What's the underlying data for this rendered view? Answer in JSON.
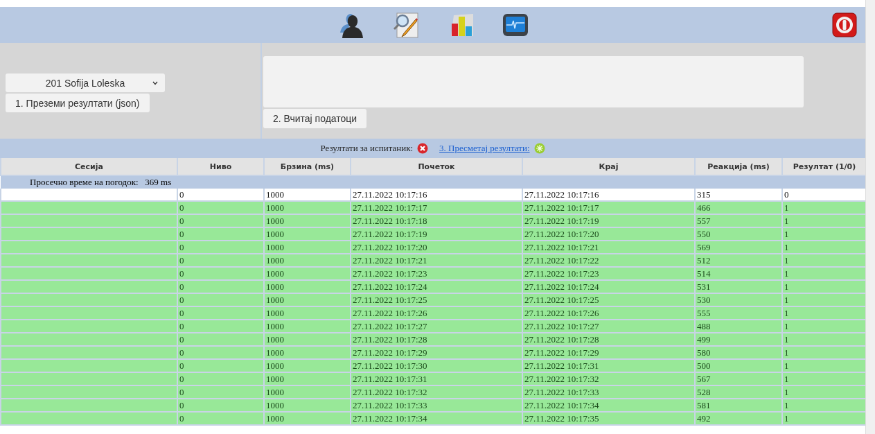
{
  "toolbar": {
    "icons": [
      {
        "kind": "person"
      },
      {
        "kind": "search-edit"
      },
      {
        "kind": "chart"
      },
      {
        "kind": "monitor"
      }
    ]
  },
  "subject_select": {
    "value": "201 Sofija Loleska"
  },
  "download_button": "1. Преземи резултати (json)",
  "load_button": "2. Вчитај податоци",
  "results_title": "Резултати за испитаник:",
  "calculate_link": "3. Пресметај резултати:",
  "table": {
    "columns": [
      "Сесија",
      "Ниво",
      "Брзина (ms)",
      "Почеток",
      "Крај",
      "Реакција (ms)",
      "Резултат (1/0)"
    ],
    "summary": "Просечно време на погодок:   369 ms",
    "rows": [
      {
        "correct": false,
        "cells": [
          "",
          "0",
          "1000",
          "27.11.2022 10:17:16",
          "27.11.2022 10:17:16",
          "315",
          "0"
        ]
      },
      {
        "correct": true,
        "cells": [
          "",
          "0",
          "1000",
          "27.11.2022 10:17:17",
          "27.11.2022 10:17:17",
          "466",
          "1"
        ]
      },
      {
        "correct": true,
        "cells": [
          "",
          "0",
          "1000",
          "27.11.2022 10:17:18",
          "27.11.2022 10:17:19",
          "557",
          "1"
        ]
      },
      {
        "correct": true,
        "cells": [
          "",
          "0",
          "1000",
          "27.11.2022 10:17:19",
          "27.11.2022 10:17:20",
          "550",
          "1"
        ]
      },
      {
        "correct": true,
        "cells": [
          "",
          "0",
          "1000",
          "27.11.2022 10:17:20",
          "27.11.2022 10:17:21",
          "569",
          "1"
        ]
      },
      {
        "correct": true,
        "cells": [
          "",
          "0",
          "1000",
          "27.11.2022 10:17:21",
          "27.11.2022 10:17:22",
          "512",
          "1"
        ]
      },
      {
        "correct": true,
        "cells": [
          "",
          "0",
          "1000",
          "27.11.2022 10:17:23",
          "27.11.2022 10:17:23",
          "514",
          "1"
        ]
      },
      {
        "correct": true,
        "cells": [
          "",
          "0",
          "1000",
          "27.11.2022 10:17:24",
          "27.11.2022 10:17:24",
          "531",
          "1"
        ]
      },
      {
        "correct": true,
        "cells": [
          "",
          "0",
          "1000",
          "27.11.2022 10:17:25",
          "27.11.2022 10:17:25",
          "530",
          "1"
        ]
      },
      {
        "correct": true,
        "cells": [
          "",
          "0",
          "1000",
          "27.11.2022 10:17:26",
          "27.11.2022 10:17:26",
          "555",
          "1"
        ]
      },
      {
        "correct": true,
        "cells": [
          "",
          "0",
          "1000",
          "27.11.2022 10:17:27",
          "27.11.2022 10:17:27",
          "488",
          "1"
        ]
      },
      {
        "correct": true,
        "cells": [
          "",
          "0",
          "1000",
          "27.11.2022 10:17:28",
          "27.11.2022 10:17:28",
          "499",
          "1"
        ]
      },
      {
        "correct": true,
        "cells": [
          "",
          "0",
          "1000",
          "27.11.2022 10:17:29",
          "27.11.2022 10:17:29",
          "580",
          "1"
        ]
      },
      {
        "correct": true,
        "cells": [
          "",
          "0",
          "1000",
          "27.11.2022 10:17:30",
          "27.11.2022 10:17:31",
          "500",
          "1"
        ]
      },
      {
        "correct": true,
        "cells": [
          "",
          "0",
          "1000",
          "27.11.2022 10:17:31",
          "27.11.2022 10:17:32",
          "567",
          "1"
        ]
      },
      {
        "correct": true,
        "cells": [
          "",
          "0",
          "1000",
          "27.11.2022 10:17:32",
          "27.11.2022 10:17:33",
          "528",
          "1"
        ]
      },
      {
        "correct": true,
        "cells": [
          "",
          "0",
          "1000",
          "27.11.2022 10:17:33",
          "27.11.2022 10:17:34",
          "581",
          "1"
        ]
      },
      {
        "correct": true,
        "cells": [
          "",
          "0",
          "1000",
          "27.11.2022 10:17:34",
          "27.11.2022 10:17:35",
          "492",
          "1"
        ]
      }
    ]
  }
}
